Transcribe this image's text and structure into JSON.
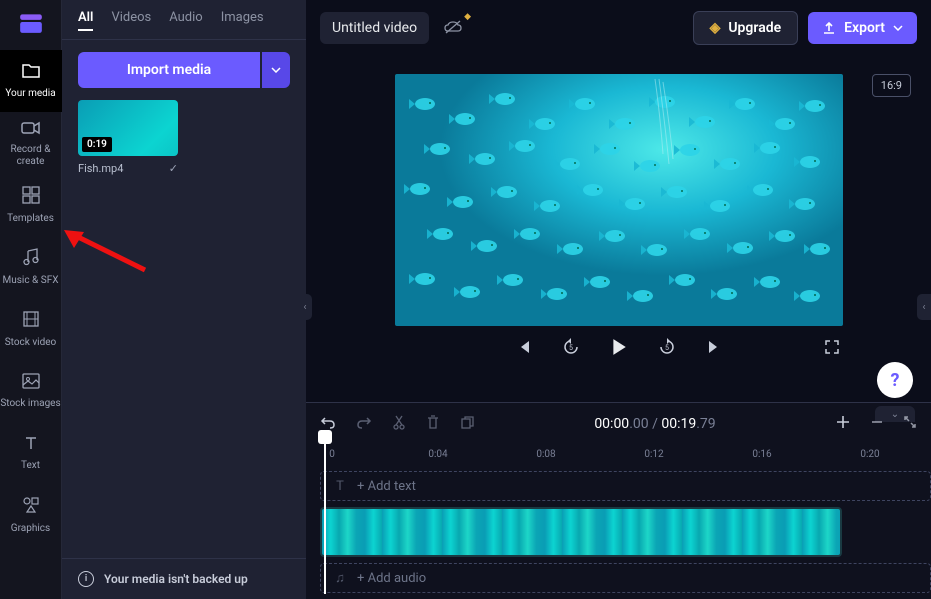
{
  "sidebar": {
    "items": [
      {
        "label": "Your media",
        "icon": "folder"
      },
      {
        "label": "Record & create",
        "icon": "camera"
      },
      {
        "label": "Templates",
        "icon": "templates"
      },
      {
        "label": "Music & SFX",
        "icon": "music"
      },
      {
        "label": "Stock video",
        "icon": "film"
      },
      {
        "label": "Stock images",
        "icon": "image"
      },
      {
        "label": "Text",
        "icon": "text"
      },
      {
        "label": "Graphics",
        "icon": "shapes"
      }
    ]
  },
  "mediaPanel": {
    "tabs": [
      "All",
      "Videos",
      "Audio",
      "Images"
    ],
    "importLabel": "Import media",
    "items": [
      {
        "name": "Fish.mp4",
        "duration": "0:19"
      }
    ],
    "backupMessage": "Your media isn't backed up"
  },
  "header": {
    "title": "Untitled video",
    "upgradeLabel": "Upgrade",
    "exportLabel": "Export"
  },
  "preview": {
    "aspect": "16:9"
  },
  "timeline": {
    "current": "00:00",
    "currentMs": ".00",
    "durSep": " / ",
    "duration": "00:19",
    "durationMs": ".79",
    "ticks": [
      "0",
      "0:04",
      "0:08",
      "0:12",
      "0:16",
      "0:20"
    ],
    "addTextLabel": "+ Add text",
    "addAudioLabel": "+ Add audio"
  }
}
